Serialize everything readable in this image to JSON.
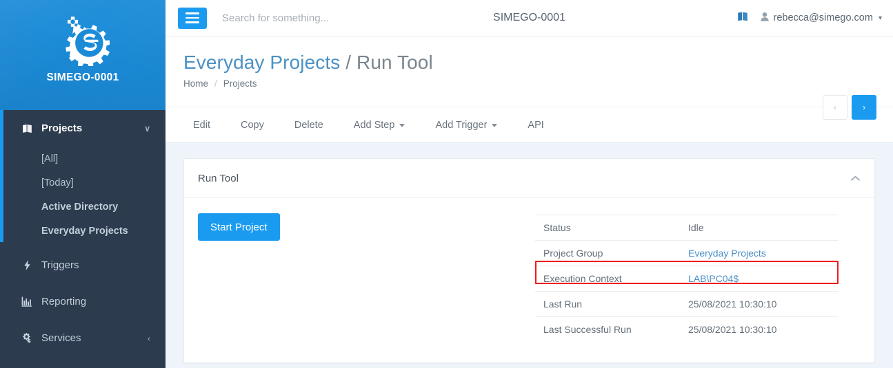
{
  "brand": {
    "logo_icon": "gear-logo-icon",
    "name": "SIMEGO-0001"
  },
  "sidebar": {
    "items": [
      {
        "label": "Projects",
        "icon": "book-icon",
        "caret": "∨",
        "active": true
      },
      {
        "label": "Triggers",
        "icon": "bolt-icon",
        "active": false
      },
      {
        "label": "Reporting",
        "icon": "bar-chart-icon",
        "active": false
      },
      {
        "label": "Services",
        "icon": "gears-icon",
        "caret": "‹",
        "active": false
      }
    ],
    "sub_items": [
      {
        "label": "[All]"
      },
      {
        "label": "[Today]"
      },
      {
        "label": "Active Directory"
      },
      {
        "label": "Everyday Projects"
      }
    ]
  },
  "topbar": {
    "menu_icon": "hamburger-icon",
    "search_placeholder": "Search for something...",
    "search_value": "",
    "title": "SIMEGO-0001",
    "book_icon": "book-icon",
    "user_icon": "user-icon",
    "user_email": "rebecca@simego.com",
    "user_caret": "▾"
  },
  "page": {
    "title_accent": "Everyday Projects",
    "title_rest": "/ Run Tool",
    "breadcrumb": [
      {
        "label": "Home"
      },
      {
        "label": "/"
      },
      {
        "label": "Projects"
      }
    ],
    "prev_label": "‹",
    "next_label": "›"
  },
  "toolbar": {
    "items": [
      {
        "label": "Edit",
        "caret": false
      },
      {
        "label": "Copy",
        "caret": false
      },
      {
        "label": "Delete",
        "caret": false
      },
      {
        "label": "Add Step",
        "caret": true
      },
      {
        "label": "Add Trigger",
        "caret": true
      },
      {
        "label": "API",
        "caret": false
      }
    ]
  },
  "panel": {
    "title": "Run Tool",
    "collapse_icon": "chevron-up-icon",
    "start_button": "Start Project",
    "rows": [
      {
        "key": "Status",
        "value": "Idle",
        "link": false
      },
      {
        "key": "Project Group",
        "value": "Everyday Projects",
        "link": true
      },
      {
        "key": "Execution Context",
        "value": "LAB\\PC04$",
        "link": true
      },
      {
        "key": "Last Run",
        "value": "25/08/2021 10:30:10",
        "link": false
      },
      {
        "key": "Last Successful Run",
        "value": "25/08/2021 10:30:10",
        "link": false
      }
    ],
    "highlight_row_index": 2,
    "highlight_color": "#ee1c1c"
  },
  "colors": {
    "brand_blue": "#1b8bd8",
    "accent_blue": "#1b9bf0",
    "sidebar_dark": "#2c3b4d",
    "content_bg": "#eef4fa",
    "link_blue": "#4b8fc6"
  }
}
